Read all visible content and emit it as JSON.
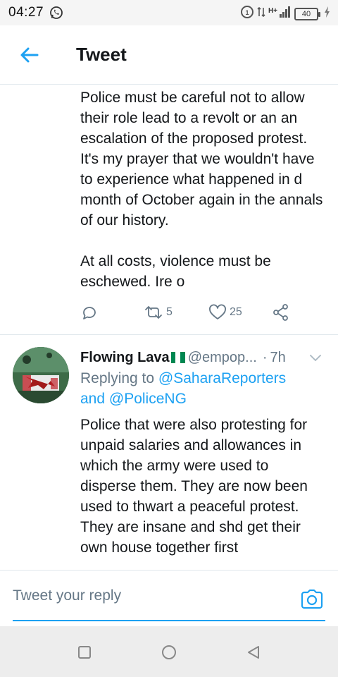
{
  "status_bar": {
    "time": "04:27",
    "battery": "40",
    "network": "H+",
    "icons": [
      "whatsapp-icon",
      "data-saver-icon",
      "data-arrows-icon",
      "signal-icon",
      "battery-icon",
      "charging-icon"
    ]
  },
  "header": {
    "title": "Tweet",
    "back_icon": "arrow-left-icon"
  },
  "main_tweet": {
    "text_paragraph_1": "Police must be careful not to allow their role lead to a revolt or an an escalation of the proposed protest. It's my prayer that we wouldn't have to experience what happened in d month of October again in the annals of our history.",
    "text_paragraph_2": "At all costs, violence must be eschewed. Ire o",
    "actions": {
      "reply_count": "",
      "retweet_count": "5",
      "like_count": "25"
    }
  },
  "reply_tweet": {
    "display_name": "Flowing Lava",
    "handle": "@empop...",
    "separator": "·",
    "time": "7h",
    "replying_prefix": "Replying to",
    "mention_1": "@SaharaReporters",
    "and_word": "and",
    "mention_2": "@PoliceNG",
    "text": "Police that were also protesting for unpaid salaries and allowances in which the army were used to disperse them. They are now been used to thwart a peaceful protest. They are insane and shd get their own house together first"
  },
  "composer": {
    "placeholder": "Tweet your reply"
  },
  "colors": {
    "accent": "#1da1f2",
    "secondary_text": "#657786",
    "divider": "#e1e8ed"
  }
}
